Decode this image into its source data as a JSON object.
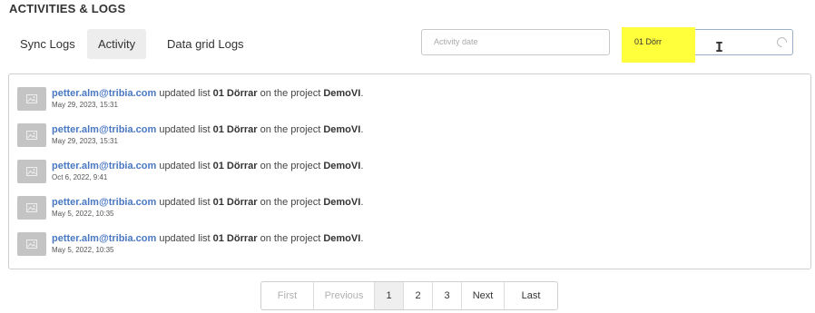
{
  "section": {
    "title": "ACTIVITIES & LOGS"
  },
  "tabs": [
    {
      "label": "Sync Logs",
      "active": false
    },
    {
      "label": "Activity",
      "active": true
    },
    {
      "label": "Data grid Logs",
      "active": false
    }
  ],
  "filters": {
    "date_placeholder": "Activity date",
    "search_value": "01 Dörr"
  },
  "logs": [
    {
      "user": "petter.alm@tribia.com",
      "action": " updated list ",
      "list": "01 Dörrar",
      "mid": " on the project ",
      "project": "DemoVI",
      "end": ".",
      "time": "May 29, 2023, 15:31"
    },
    {
      "user": "petter.alm@tribia.com",
      "action": " updated list ",
      "list": "01 Dörrar",
      "mid": " on the project ",
      "project": "DemoVI",
      "end": ".",
      "time": "May 29, 2023, 15:31"
    },
    {
      "user": "petter.alm@tribia.com",
      "action": " updated list ",
      "list": "01 Dörrar",
      "mid": " on the project ",
      "project": "DemoVI",
      "end": ".",
      "time": "Oct 6, 2022, 9:41"
    },
    {
      "user": "petter.alm@tribia.com",
      "action": " updated list ",
      "list": "01 Dörrar",
      "mid": " on the project ",
      "project": "DemoVI",
      "end": ".",
      "time": "May 5, 2022, 10:35"
    },
    {
      "user": "petter.alm@tribia.com",
      "action": " updated list ",
      "list": "01 Dörrar",
      "mid": " on the project ",
      "project": "DemoVI",
      "end": ".",
      "time": "May 5, 2022, 10:35"
    }
  ],
  "pagination": {
    "first": "First",
    "previous": "Previous",
    "pages": [
      "1",
      "2",
      "3"
    ],
    "current_page": "1",
    "next": "Next",
    "last": "Last"
  },
  "icons": {
    "avatar": "image-placeholder-icon",
    "loading": "spinner-icon",
    "cursor": "text-cursor-icon"
  }
}
